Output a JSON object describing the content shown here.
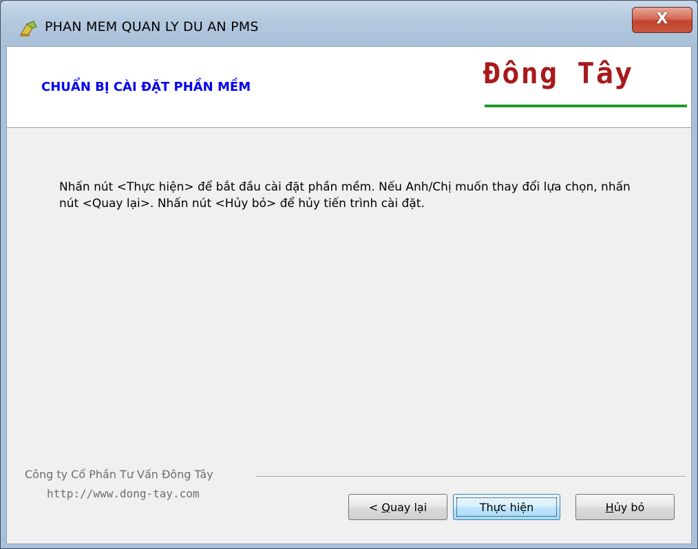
{
  "window": {
    "title": "PHAN MEM QUAN LY DU AN PMS",
    "close_label": "X"
  },
  "header": {
    "title": "CHUẨN BỊ CÀI ĐẶT PHẦN MỀM",
    "logo_text": "Đông Tây",
    "logo_color": "#a8191c",
    "logo_underline_color": "#1f9a2a"
  },
  "body": {
    "message": "Nhấn nút <Thực hiện> để bắt đầu cài đặt phần mềm. Nếu Anh/Chị muốn thay đổi lựa chọn, nhấn nút <Quay lại>. Nhấn nút <Hủy bỏ> để hủy tiến trình cài đặt."
  },
  "footer": {
    "company": "Công ty Cổ Phần Tư Vấn Đông Tây",
    "url": "http://www.dong-tay.com"
  },
  "buttons": {
    "back_prefix": "< ",
    "back_accel": "Q",
    "back_rest": "uay lại",
    "next_label": "Thực hiện",
    "cancel_accel": "H",
    "cancel_rest": "ủy bỏ"
  },
  "icons": {
    "app": "installer-app-icon",
    "close": "close-icon"
  }
}
